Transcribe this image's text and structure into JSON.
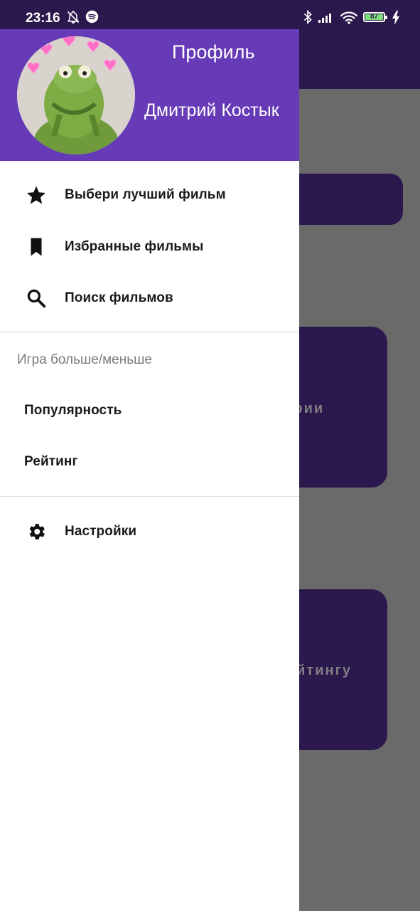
{
  "status_bar": {
    "time": "23:16",
    "battery": "87",
    "icons": [
      "notifications-off-icon",
      "spotify-icon",
      "bluetooth-icon",
      "signal-icon",
      "wifi-icon",
      "battery-icon",
      "charging-icon"
    ]
  },
  "colors": {
    "primary": "#673ab7",
    "primary_dark": "#2b184d",
    "scrim": "#6a6a6a",
    "drawer_bg": "#ffffff"
  },
  "background": {
    "card_2_text": "егории",
    "card_3_text": "ейтингу"
  },
  "drawer": {
    "header": {
      "title": "Профиль",
      "name": "Дмитрий Костык",
      "avatar": "avatar-image"
    },
    "items": [
      {
        "label": "Выбери лучший фильм",
        "icon": "star-icon"
      },
      {
        "label": "Избранные фильмы",
        "icon": "bookmark-icon"
      },
      {
        "label": "Поиск фильмов",
        "icon": "search-icon"
      }
    ],
    "game_section": {
      "title": "Игра больше/меньше",
      "items": [
        {
          "label": "Популярность"
        },
        {
          "label": "Рейтинг"
        }
      ]
    },
    "settings": {
      "label": "Настройки",
      "icon": "gear-icon"
    }
  }
}
